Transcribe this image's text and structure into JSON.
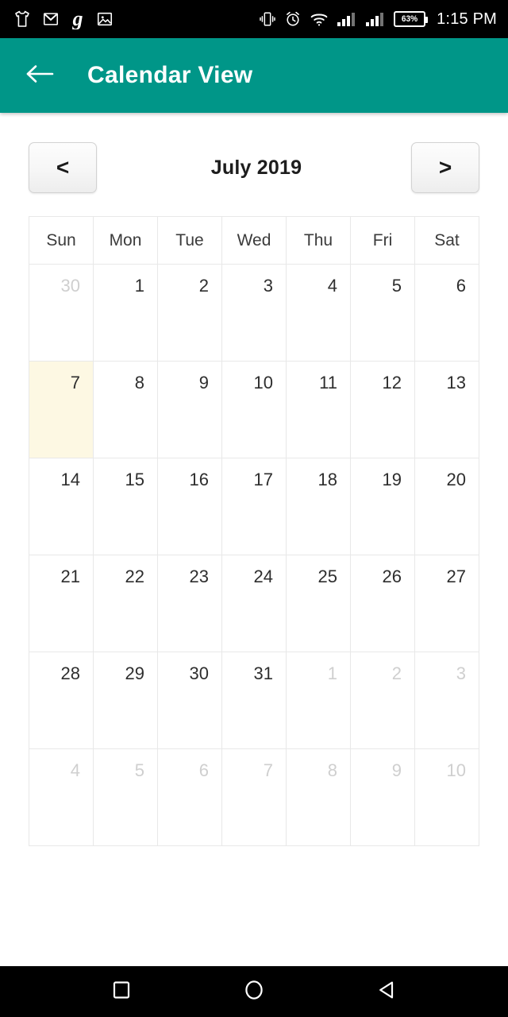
{
  "status_bar": {
    "background": "#000000",
    "time": "1:15 PM",
    "battery_percent": "63%",
    "left_icons": [
      {
        "name": "tshirt-icon"
      },
      {
        "name": "gmail-icon"
      },
      {
        "name": "goodreads-g-icon"
      },
      {
        "name": "photos-image-icon"
      }
    ],
    "right_icons": [
      {
        "name": "vibrate-icon"
      },
      {
        "name": "alarm-clock-icon"
      },
      {
        "name": "wifi-icon"
      },
      {
        "name": "signal-bars-sim1-icon"
      },
      {
        "name": "signal-bars-sim2-icon"
      },
      {
        "name": "battery-icon"
      }
    ]
  },
  "app_bar": {
    "title": "Calendar View",
    "background": "#009688",
    "text_color": "#ffffff",
    "back_icon": "arrow-left-icon"
  },
  "month_nav": {
    "prev_label": "<",
    "next_label": ">",
    "month_title": "July 2019"
  },
  "calendar": {
    "weekday_headers": [
      "Sun",
      "Mon",
      "Tue",
      "Wed",
      "Thu",
      "Fri",
      "Sat"
    ],
    "today_highlight_color": "#fdf8e3",
    "muted_color": "#cfcfcf",
    "weeks": [
      [
        {
          "day": "30",
          "muted": true,
          "today": false
        },
        {
          "day": "1",
          "muted": false,
          "today": false
        },
        {
          "day": "2",
          "muted": false,
          "today": false
        },
        {
          "day": "3",
          "muted": false,
          "today": false
        },
        {
          "day": "4",
          "muted": false,
          "today": false
        },
        {
          "day": "5",
          "muted": false,
          "today": false
        },
        {
          "day": "6",
          "muted": false,
          "today": false
        }
      ],
      [
        {
          "day": "7",
          "muted": false,
          "today": true
        },
        {
          "day": "8",
          "muted": false,
          "today": false
        },
        {
          "day": "9",
          "muted": false,
          "today": false
        },
        {
          "day": "10",
          "muted": false,
          "today": false
        },
        {
          "day": "11",
          "muted": false,
          "today": false
        },
        {
          "day": "12",
          "muted": false,
          "today": false
        },
        {
          "day": "13",
          "muted": false,
          "today": false
        }
      ],
      [
        {
          "day": "14",
          "muted": false,
          "today": false
        },
        {
          "day": "15",
          "muted": false,
          "today": false
        },
        {
          "day": "16",
          "muted": false,
          "today": false
        },
        {
          "day": "17",
          "muted": false,
          "today": false
        },
        {
          "day": "18",
          "muted": false,
          "today": false
        },
        {
          "day": "19",
          "muted": false,
          "today": false
        },
        {
          "day": "20",
          "muted": false,
          "today": false
        }
      ],
      [
        {
          "day": "21",
          "muted": false,
          "today": false
        },
        {
          "day": "22",
          "muted": false,
          "today": false
        },
        {
          "day": "23",
          "muted": false,
          "today": false
        },
        {
          "day": "24",
          "muted": false,
          "today": false
        },
        {
          "day": "25",
          "muted": false,
          "today": false
        },
        {
          "day": "26",
          "muted": false,
          "today": false
        },
        {
          "day": "27",
          "muted": false,
          "today": false
        }
      ],
      [
        {
          "day": "28",
          "muted": false,
          "today": false
        },
        {
          "day": "29",
          "muted": false,
          "today": false
        },
        {
          "day": "30",
          "muted": false,
          "today": false
        },
        {
          "day": "31",
          "muted": false,
          "today": false
        },
        {
          "day": "1",
          "muted": true,
          "today": false
        },
        {
          "day": "2",
          "muted": true,
          "today": false
        },
        {
          "day": "3",
          "muted": true,
          "today": false
        }
      ],
      [
        {
          "day": "4",
          "muted": true,
          "today": false
        },
        {
          "day": "5",
          "muted": true,
          "today": false
        },
        {
          "day": "6",
          "muted": true,
          "today": false
        },
        {
          "day": "7",
          "muted": true,
          "today": false
        },
        {
          "day": "8",
          "muted": true,
          "today": false
        },
        {
          "day": "9",
          "muted": true,
          "today": false
        },
        {
          "day": "10",
          "muted": true,
          "today": false
        }
      ]
    ]
  },
  "system_nav": {
    "background": "#000000",
    "keys": [
      {
        "name": "recents-square-icon"
      },
      {
        "name": "home-circle-icon"
      },
      {
        "name": "back-triangle-icon"
      }
    ]
  }
}
